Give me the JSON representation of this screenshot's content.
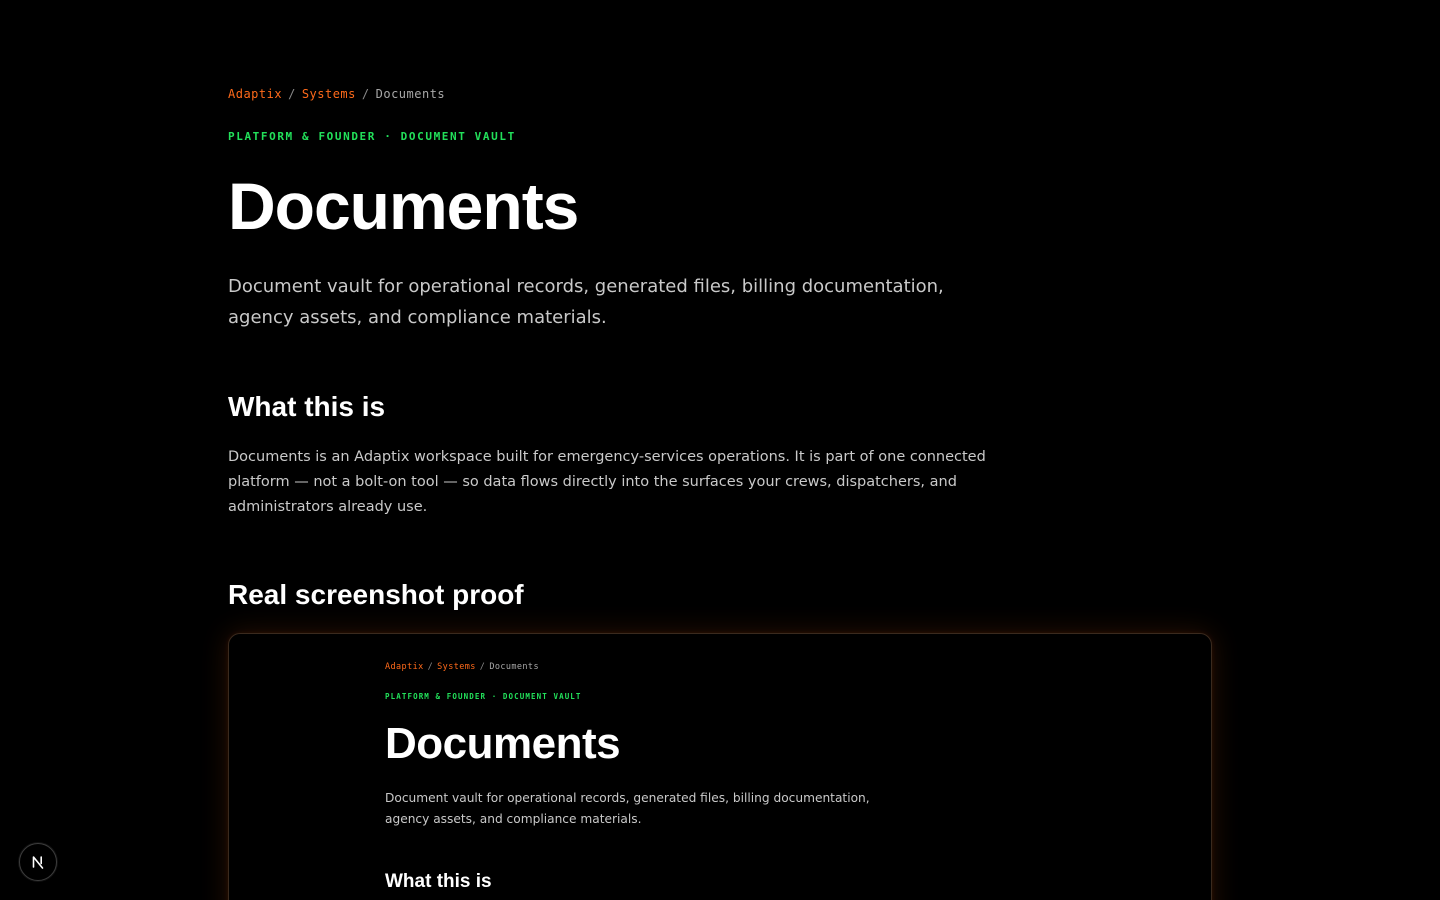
{
  "breadcrumb": {
    "items": [
      {
        "label": "Adaptix"
      },
      {
        "label": "Systems"
      }
    ],
    "separator": "/",
    "current": "Documents"
  },
  "eyebrow": "PLATFORM & FOUNDER · DOCUMENT VAULT",
  "title": "Documents",
  "lede": "Document vault for operational records, generated files, billing documentation, agency assets, and compliance materials.",
  "what_this_is": {
    "heading": "What this is",
    "body": "Documents is an Adaptix workspace built for emergency-services operations. It is part of one connected platform — not a bolt-on tool — so data flows directly into the surfaces your crews, dispatchers, and administrators already use."
  },
  "screenshot_proof": {
    "heading": "Real screenshot proof",
    "preview": {
      "breadcrumb": {
        "items": [
          {
            "label": "Adaptix"
          },
          {
            "label": "Systems"
          }
        ],
        "separator": "/",
        "current": "Documents"
      },
      "eyebrow": "PLATFORM & FOUNDER · DOCUMENT VAULT",
      "title": "Documents",
      "lede": "Document vault for operational records, generated files, billing documentation, agency assets, and compliance materials.",
      "heading": "What this is"
    }
  },
  "devtools_badge": {
    "icon": "nextjs-logo-icon",
    "glyph": "N"
  },
  "colors": {
    "background": "#000000",
    "accent_link": "#ff6a1a",
    "eyebrow_green": "#22e05a",
    "body_text": "#c9c9c9",
    "muted": "#8a8a8a"
  }
}
